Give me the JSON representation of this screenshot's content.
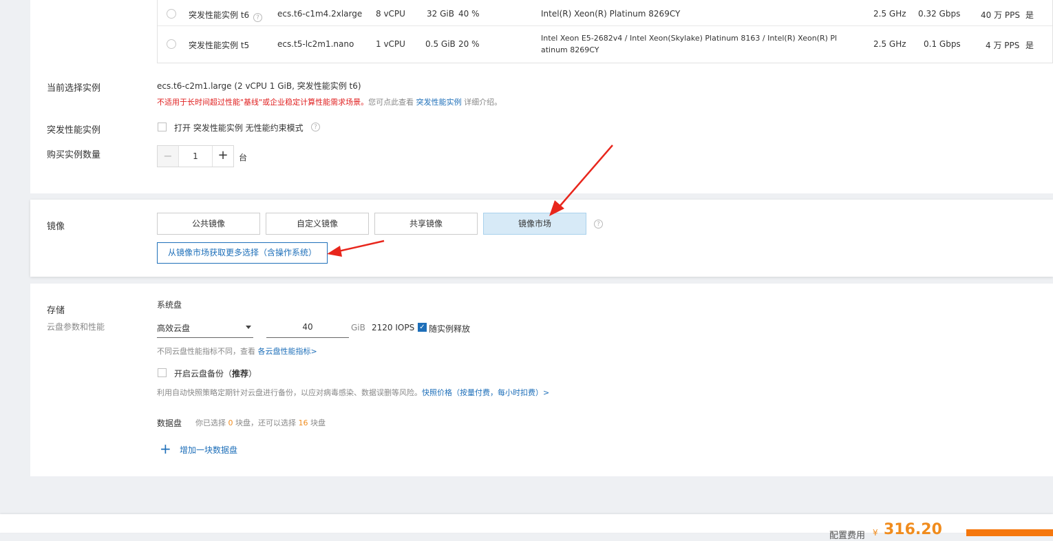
{
  "instance_table": {
    "rows": [
      {
        "family": "突发性能实例 t6",
        "spec": "ecs.t6-c1m4.2xlarge",
        "vcpu": "8 vCPU",
        "memory": "32 GiB",
        "baseline": "40 %",
        "processor": "Intel(R) Xeon(R) Platinum 8269CY",
        "processor_line2": "",
        "clock": "2.5 GHz",
        "bandwidth": "0.32 Gbps",
        "pps": "40 万 PPS",
        "ipv6": "是"
      },
      {
        "family": "突发性能实例 t5",
        "spec": "ecs.t5-lc2m1.nano",
        "vcpu": "1 vCPU",
        "memory": "0.5 GiB",
        "baseline": "20 %",
        "processor": "Intel Xeon E5-2682v4 / Intel Xeon(Skylake) Platinum 8163 / Intel(R) Xeon(R) Pl",
        "processor_line2": "atinum 8269CY",
        "clock": "2.5 GHz",
        "bandwidth": "0.1 Gbps",
        "pps": "4 万 PPS",
        "ipv6": "是"
      }
    ]
  },
  "current_instance": {
    "label": "当前选择实例",
    "value": "ecs.t6-c2m1.large (2 vCPU 1 GiB, 突发性能实例 t6)",
    "warning": "不适用于长时间超过性能\"基线\"或企业稳定计算性能需求场景。",
    "hint_prefix": "您可点此查看",
    "hint_link": "突发性能实例",
    "hint_suffix": "详细介绍。"
  },
  "burst": {
    "label": "突发性能实例",
    "checkbox_prefix": "打开",
    "checkbox_text": "突发性能实例 无性能约束模式"
  },
  "quantity": {
    "label": "购买实例数量",
    "minus": "−",
    "value": "1",
    "plus": "+",
    "unit": "台"
  },
  "image": {
    "label": "镜像",
    "tabs": [
      "公共镜像",
      "自定义镜像",
      "共享镜像",
      "镜像市场"
    ],
    "active_tab": 3,
    "market_button": "从镜像市场获取更多选择（含操作系统）"
  },
  "storage": {
    "label": "存储",
    "sublabel": "云盘参数和性能",
    "system_disk_title": "系统盘",
    "disk_type": "高效云盘",
    "size": "40",
    "unit": "GiB",
    "iops": "2120 IOPS",
    "release_label": "随实例释放",
    "perf_note": "不同云盘性能指标不同，查看",
    "perf_link": "各云盘性能指标>",
    "backup_label": "开启云盘备份（",
    "backup_recommend": "推荐",
    "backup_close": "）",
    "backup_desc": "利用自动快照策略定期针对云盘进行备份，以应对病毒感染、数据误删等风险。",
    "snapshot_link": "快照价格（按量付费，每小时扣费）>",
    "data_disk_title": "数据盘",
    "data_prefix": "你已选择",
    "data_selected": "0",
    "data_mid": "块盘，还可以选择",
    "data_remaining": "16",
    "data_suffix": "块盘",
    "add_icon": "+",
    "add_label": "增加一块数据盘"
  },
  "footer": {
    "fee_label": "配置费用",
    "currency": "¥",
    "price": "316.20"
  }
}
